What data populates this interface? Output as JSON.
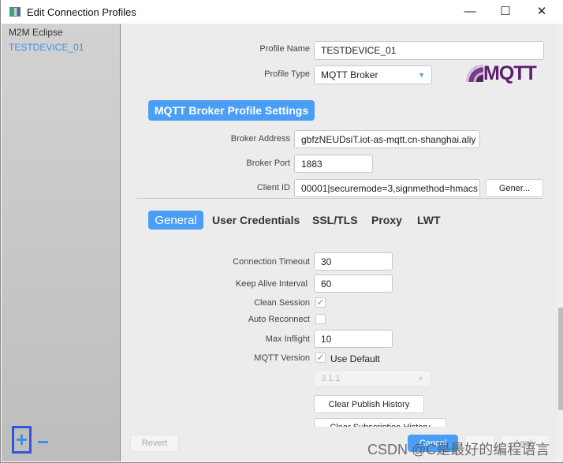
{
  "window": {
    "title": "Edit Connection Profiles",
    "controls": {
      "minimize": "—",
      "maximize": "☐",
      "close": "✕"
    }
  },
  "sidebar": {
    "items": [
      {
        "label": "M2M Eclipse",
        "color": "#333333"
      },
      {
        "label": "TESTDEVICE_01",
        "color": "#3d8fe6"
      }
    ],
    "add_label": "+",
    "remove_label": "−"
  },
  "profile": {
    "name_label": "Profile Name",
    "name_value": "TESTDEVICE_01",
    "type_label": "Profile Type",
    "type_value": "MQTT Broker",
    "logo": "MQTT"
  },
  "broker": {
    "section_title": "MQTT Broker Profile Settings",
    "address_label": "Broker Address",
    "address_value": "gbfzNEUDsiT.iot-as-mqtt.cn-shanghai.aliy",
    "port_label": "Broker Port",
    "port_value": "1883",
    "client_id_label": "Client ID",
    "client_id_value": "00001|securemode=3,signmethod=hmacs",
    "generate_label": "Gener..."
  },
  "tabs": [
    {
      "label": "General",
      "active": true
    },
    {
      "label": "User Credentials"
    },
    {
      "label": "SSL/TLS"
    },
    {
      "label": "Proxy"
    },
    {
      "label": "LWT"
    }
  ],
  "general": {
    "timeout_label": "Connection Timeout",
    "timeout_value": "30",
    "keepalive_label": "Keep Alive Interval",
    "keepalive_value": "60",
    "clean_label": "Clean Session",
    "clean_checked": true,
    "reconnect_label": "Auto Reconnect",
    "reconnect_checked": false,
    "inflight_label": "Max Inflight",
    "inflight_value": "10",
    "version_label": "MQTT Version",
    "use_default_label": "Use Default",
    "use_default_checked": true,
    "version_value": "3.1.1",
    "clear_publish_label": "Clear Publish History",
    "clear_subscription_label": "Clear Subscription History"
  },
  "footer": {
    "revert_label": "Revert",
    "cancel_label": "Cancel",
    "apply_label": "Apply"
  },
  "watermark": "CSDN @C是最好的编程语言",
  "colors": {
    "accent": "#4a9ff5"
  }
}
